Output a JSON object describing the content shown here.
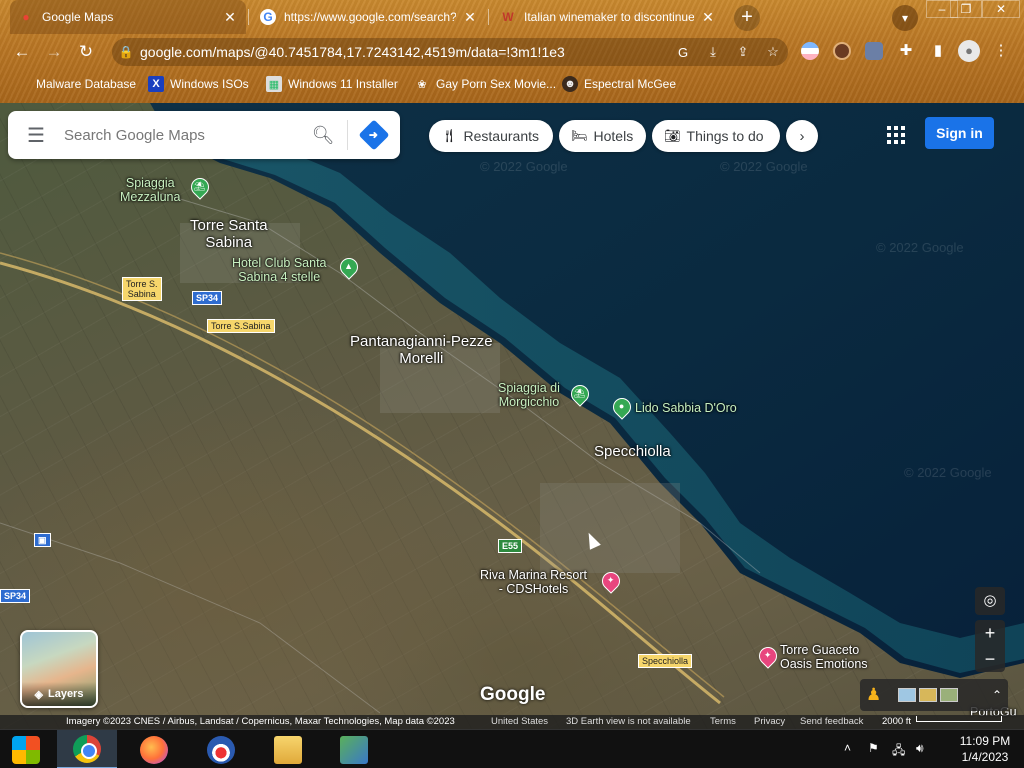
{
  "browser": {
    "tabs": [
      {
        "title": "Google Maps",
        "favicon": "google-maps-pin-icon"
      },
      {
        "title": "https://www.google.com/search?q",
        "favicon": "google-g-icon"
      },
      {
        "title": "Italian winemaker to discontinue",
        "favicon": "news-icon"
      }
    ],
    "new_tab_label": "+",
    "window_controls": {
      "minimize": "–",
      "maximize": "❐",
      "close": "✕"
    },
    "address": "google.com/maps/@40.7451784,17.7243142,4519m/data=!3m1!1e3",
    "bookmarks": [
      {
        "label": "Malware Database"
      },
      {
        "label": "Windows ISOs"
      },
      {
        "label": "Windows 11 Installer"
      },
      {
        "label": "Gay Porn Sex Movie..."
      },
      {
        "label": "Espectral McGee"
      }
    ]
  },
  "maps": {
    "search": {
      "placeholder": "Search Google Maps",
      "value": ""
    },
    "chips": [
      {
        "label": "Restaurants",
        "icon": "fork-knife-icon"
      },
      {
        "label": "Hotels",
        "icon": "bed-icon"
      },
      {
        "label": "Things to do",
        "icon": "camera-icon"
      }
    ],
    "sign_in": "Sign in",
    "layers_label": "Layers",
    "places": {
      "torre_santa_sabina": "Torre Santa\nSabina",
      "pantanagianni": "Pantanagianni-Pezze\nMorelli",
      "specchiolla": "Specchiolla"
    },
    "pois": {
      "spiaggia_mezzaluna": "Spiaggia\nMezzaluna",
      "hotel_club": "Hotel Club Santa\nSabina 4 stelle",
      "spiaggia_morgicchio": "Spiaggia di\nMorgicchio",
      "lido_sabbia": "Lido Sabbia D'Oro",
      "riva_marina": "Riva Marina Resort\n- CDSHotels",
      "torre_guaceto": "Torre Guaceto\nOasis Emotions",
      "portoguaceto": "PortoGu"
    },
    "roads": {
      "torre_s_sabina_1": "Torre S.\nSabina",
      "torre_s_sabina_2": "Torre S.Sabina",
      "sp34_1": "SP34",
      "sp34_2": "SP34",
      "e55": "E55",
      "specchiolla_road": "Specchiolla"
    },
    "watermarks": [
      "© 2022 Google",
      "© 2022 Google",
      "© 2022 Google",
      "© 2022 Google"
    ],
    "logo": "Google",
    "attribution": {
      "imagery": "Imagery ©2023 CNES / Airbus, Landsat / Copernicus, Maxar Technologies, Map data ©2023",
      "country": "United States",
      "earth": "3D Earth view is not available",
      "terms": "Terms",
      "privacy": "Privacy",
      "feedback": "Send feedback",
      "scale": "2000 ft"
    }
  },
  "taskbar": {
    "time": "11:09 PM",
    "date": "1/4/2023"
  }
}
